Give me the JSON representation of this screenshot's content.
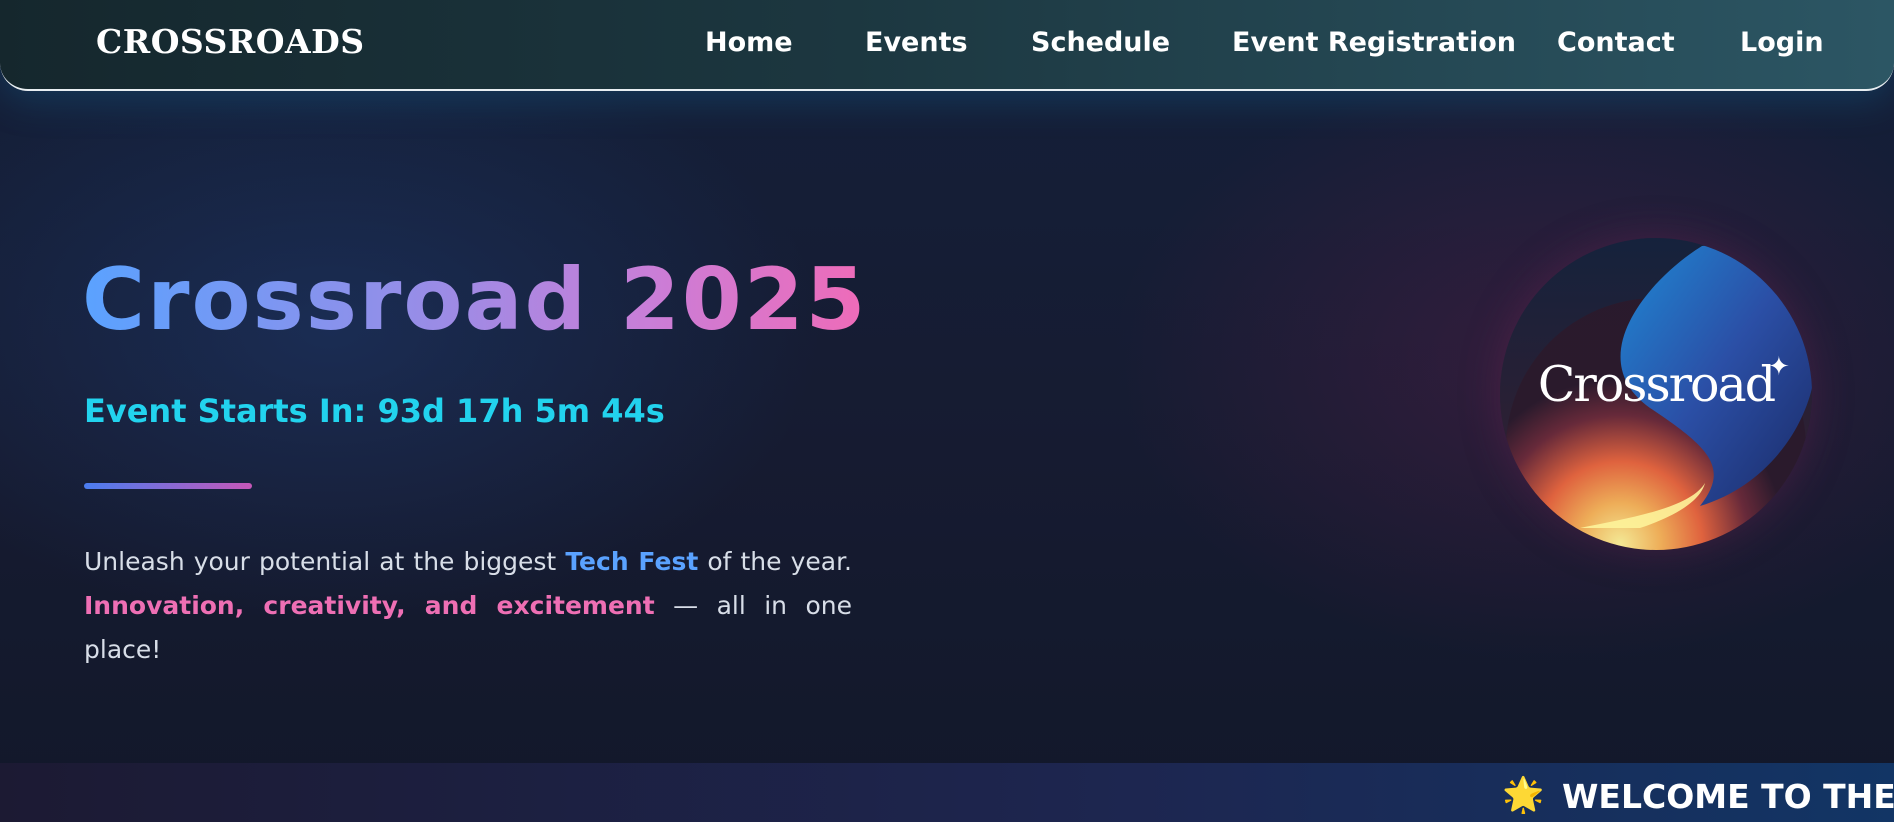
{
  "nav": {
    "brand": "CROSSROADS",
    "links": [
      "Home",
      "Events",
      "Schedule",
      "Event Registration",
      "Contact",
      "Login"
    ]
  },
  "hero": {
    "title": "Crossroad 2025",
    "countdown": "Event Starts In: 93d 17h 5m 44s",
    "tagline_start": "Unleash your potential at the biggest",
    "tagline_highlight1": "Tech Fest",
    "tagline_mid": "of the year.",
    "tagline_highlight2": "Innovation, creativity, and excitement",
    "tagline_end": "— all in one place!"
  },
  "logo": {
    "text": "Crossroad",
    "sparkle": "✦"
  },
  "banner": {
    "icon": "star-icon",
    "icon_glyph": "🌟",
    "text": "WELCOME TO THE"
  },
  "colors": {
    "countdown": "#22d3ee",
    "highlight_blue": "#5aa2ff",
    "highlight_pink": "#ee6fb4"
  }
}
